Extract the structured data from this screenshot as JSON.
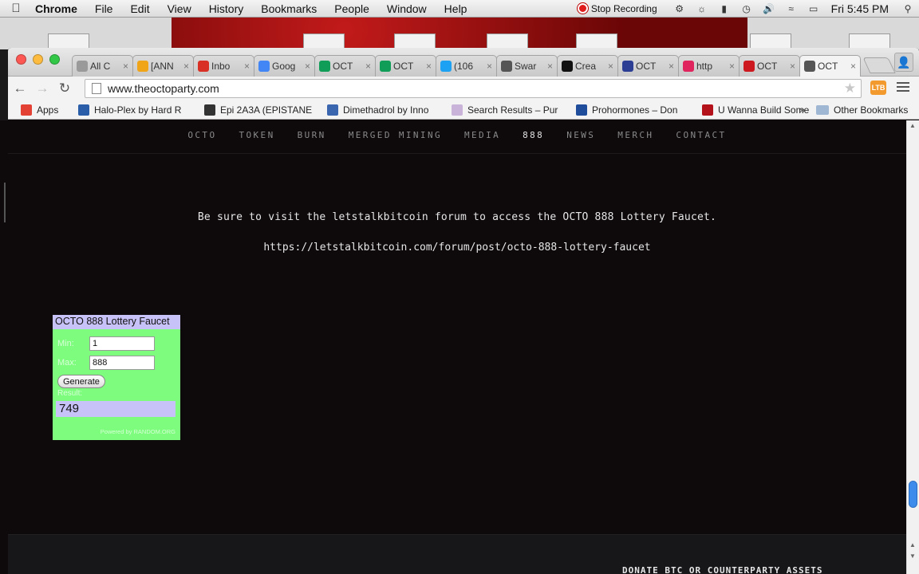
{
  "menubar": {
    "app": "Chrome",
    "items": [
      "File",
      "Edit",
      "View",
      "History",
      "Bookmarks",
      "People",
      "Window",
      "Help"
    ],
    "recording": "Stop Recording",
    "clock": "Fri 5:45 PM"
  },
  "browser": {
    "tabs": [
      {
        "label": "All C",
        "color": "#9a9a9a"
      },
      {
        "label": "[ANN",
        "color": "#f0a418"
      },
      {
        "label": "Inbo",
        "color": "#d93025"
      },
      {
        "label": "Goog",
        "color": "#4285f4"
      },
      {
        "label": "OCT",
        "color": "#0f9d58"
      },
      {
        "label": "OCT",
        "color": "#0f9d58"
      },
      {
        "label": "(106",
        "color": "#1da1f2"
      },
      {
        "label": "Swar",
        "color": "#555555"
      },
      {
        "label": "Crea",
        "color": "#111111"
      },
      {
        "label": "OCT",
        "color": "#2c3e94"
      },
      {
        "label": "http",
        "color": "#e0245e"
      },
      {
        "label": "OCT",
        "color": "#cc181e"
      },
      {
        "label": "OCT",
        "color": "#555555"
      }
    ],
    "url": "www.theoctoparty.com",
    "bookmarks": [
      {
        "label": "Apps",
        "color": "#e34133"
      },
      {
        "label": "Halo-Plex by Hard R",
        "color": "#2a5ea8"
      },
      {
        "label": "Epi 2A3A (EPISTANE",
        "color": "#333333"
      },
      {
        "label": "Dimethadrol by Inno",
        "color": "#3a66b0"
      },
      {
        "label": "Search Results – Pur",
        "color": "#c9b3d9"
      },
      {
        "label": "Prohormones – Don",
        "color": "#1f4d9c"
      },
      {
        "label": "U Wanna Build Some",
        "color": "#b3121a"
      }
    ],
    "other_bookmarks": "Other Bookmarks",
    "ext_label": "LTB"
  },
  "site": {
    "nav": [
      "OCTO",
      "TOKEN",
      "BURN",
      "MERGED MINING",
      "MEDIA",
      "888",
      "NEWS",
      "MERCH",
      "CONTACT"
    ],
    "active_nav": "888",
    "notice": "Be sure to visit the letstalkbitcoin forum to access the OCTO 888 Lottery Faucet.",
    "link": "https://letstalkbitcoin.com/forum/post/octo-888-lottery-faucet",
    "footer_text": "DONATE BTC OR COUNTERPARTY ASSETS"
  },
  "faucet": {
    "title": "OCTO 888 Lottery Faucet",
    "min_label": "Min:",
    "min_value": "1",
    "max_label": "Max:",
    "max_value": "888",
    "generate_label": "Generate",
    "result_label": "Result:",
    "result_value": "749",
    "powered_by": "Powered by RANDOM.ORG"
  },
  "colors": {
    "faucet_bg": "#7dfc7d",
    "faucet_accent": "#c7c2f7",
    "page_bg": "#0e0a0c",
    "scroll_thumb": "#3d8bea"
  }
}
